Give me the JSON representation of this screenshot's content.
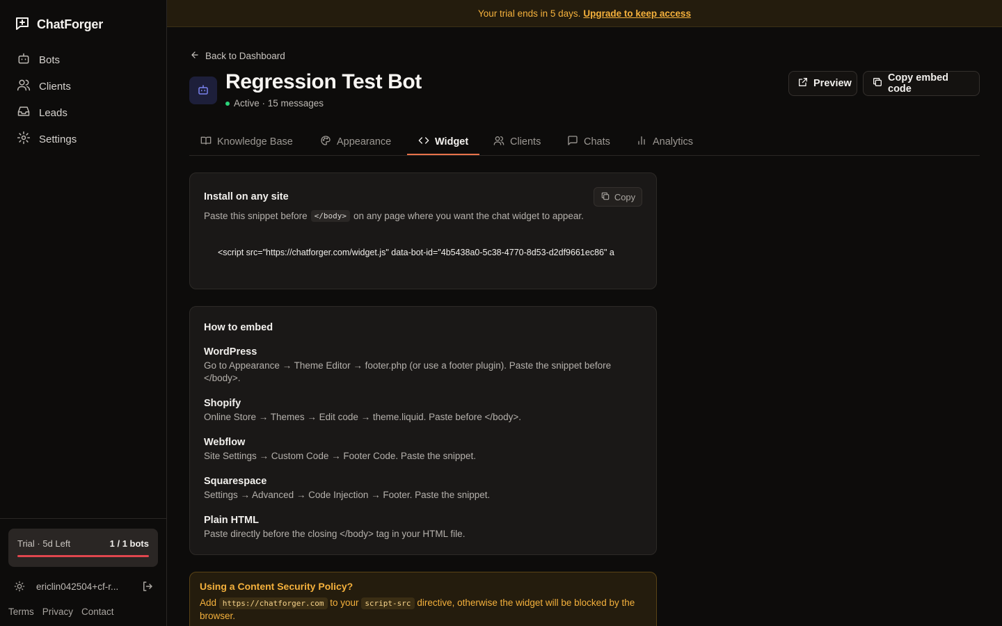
{
  "app": {
    "name": "ChatForger"
  },
  "sidebar": {
    "items": [
      {
        "label": "Bots",
        "icon": "bot-icon"
      },
      {
        "label": "Clients",
        "icon": "users-icon"
      },
      {
        "label": "Leads",
        "icon": "inbox-icon"
      },
      {
        "label": "Settings",
        "icon": "gear-icon"
      }
    ],
    "trial": {
      "status": "Trial · 5d Left",
      "usage": "1 / 1 bots"
    },
    "user": {
      "email": "ericlin042504+cf-r..."
    },
    "footer": {
      "terms": "Terms",
      "privacy": "Privacy",
      "contact": "Contact"
    }
  },
  "banner": {
    "text": "Your trial ends in 5 days.",
    "link": "Upgrade to keep access"
  },
  "header": {
    "back": "Back to Dashboard",
    "title": "Regression Test Bot",
    "status": "Active · 15 messages",
    "preview": "Preview",
    "copy_embed": "Copy embed code"
  },
  "tabs": [
    {
      "label": "Knowledge Base"
    },
    {
      "label": "Appearance"
    },
    {
      "label": "Widget",
      "active": true
    },
    {
      "label": "Clients"
    },
    {
      "label": "Chats"
    },
    {
      "label": "Analytics"
    }
  ],
  "install": {
    "title": "Install on any site",
    "copy": "Copy",
    "desc_before": "Paste this snippet before",
    "desc_code": "</body>",
    "desc_after": "on any page where you want the chat widget to appear.",
    "snippet": "<script src=\"https://chatforger.com/widget.js\" data-bot-id=\"4b5438a0-5c38-4770-8d53-d2df9661ec86\" a"
  },
  "how": {
    "title": "How to embed",
    "items": [
      {
        "name": "WordPress",
        "desc": "Go to Appearance → Theme Editor → footer.php (or use a footer plugin). Paste the snippet before </body>."
      },
      {
        "name": "Shopify",
        "desc": "Online Store → Themes → Edit code → theme.liquid. Paste before </body>."
      },
      {
        "name": "Webflow",
        "desc": "Site Settings → Custom Code → Footer Code. Paste the snippet."
      },
      {
        "name": "Squarespace",
        "desc": "Settings → Advanced → Code Injection → Footer. Paste the snippet."
      },
      {
        "name": "Plain HTML",
        "desc": "Paste directly before the closing </body> tag in your HTML file."
      }
    ]
  },
  "csp": {
    "title": "Using a Content Security Policy?",
    "pre": "Add",
    "code1": "https://chatforger.com",
    "mid": "to your",
    "code2": "script-src",
    "post": "directive, otherwise the widget will be blocked by the browser."
  },
  "colors": {
    "accent": "#e8724a",
    "warning": "#f5b13c",
    "status_active": "#2bd47a",
    "trial_bar": "#e0464e"
  }
}
